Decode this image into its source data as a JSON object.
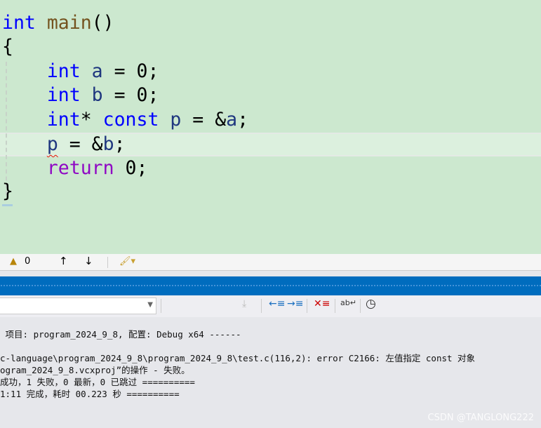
{
  "editor": {
    "lines": [
      {
        "parts": [
          "int",
          " ",
          "main",
          "()"
        ]
      },
      {
        "parts": [
          "{"
        ]
      },
      {
        "parts": [
          "    ",
          "int",
          " ",
          "a",
          " = 0;"
        ]
      },
      {
        "parts": [
          "    ",
          "int",
          " ",
          "b",
          " = 0;"
        ]
      },
      {
        "parts": [
          "    ",
          "int",
          "* ",
          "const",
          " ",
          "p",
          " = &",
          "a",
          ";"
        ]
      },
      {
        "parts": [
          "    ",
          "p",
          " = &",
          "b",
          ";"
        ]
      },
      {
        "parts": [
          "    ",
          "return",
          " 0;"
        ]
      },
      {
        "parts": [
          "}"
        ]
      }
    ]
  },
  "statusbar": {
    "warning_count": "0",
    "up_icon": "arrow-up-icon",
    "down_icon": "arrow-down-icon",
    "cleanup_icon": "brush-icon"
  },
  "output": {
    "lines": [
      " 项目: program_2024_9_8, 配置: Debug x64 ------",
      "",
      "c-language\\program_2024_9_8\\program_2024_9_8\\test.c(116,2): error C2166: 左值指定 const 对象",
      "ogram_2024_9_8.vcxproj”的操作 - 失败。",
      "成功，1 失败，0 最新，0 已跳过 ==========",
      "1:11 完成，耗时 00.223 秒 =========="
    ]
  },
  "watermark": "CSDN @TANGLONG222",
  "colors": {
    "editor_bg": "#cce8cf",
    "keyword": "#0000ff",
    "function": "#74531f",
    "variable": "#1f377f",
    "control": "#8f08c4",
    "accent": "#006cbe"
  }
}
